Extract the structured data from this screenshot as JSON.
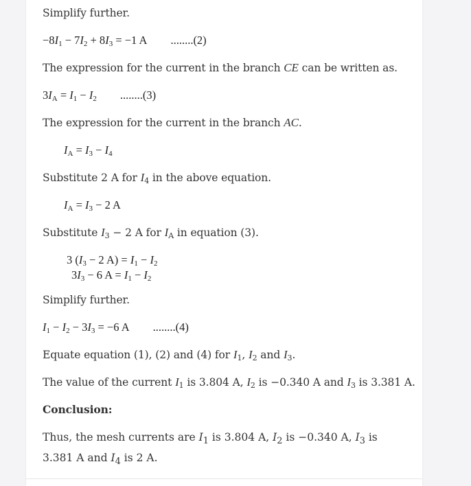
{
  "content": {
    "p1": "Simplify further.",
    "eq2": {
      "lhs_1": "−8",
      "var1": "I",
      "sub1": "1",
      "op1": " − 7",
      "var2": "I",
      "sub2": "2",
      "op2": " + 8",
      "var3": "I",
      "sub3": "3",
      "rhs": " = −1 A",
      "tag": "........(2)"
    },
    "p2": {
      "before": "The expression for the current in the branch ",
      "var": "CE",
      "after": " can be written as."
    },
    "eq3": {
      "lhs": "3",
      "var1": "I",
      "sub1": "A",
      "mid": " = ",
      "var2": "I",
      "sub2": "1",
      "op": " − ",
      "var3": "I",
      "sub3": "2",
      "tag": "........(3)"
    },
    "p3": {
      "before": "The expression for the current in the branch ",
      "var": "AC",
      "after": "."
    },
    "eq_ia": {
      "var1": "I",
      "sub1": "A",
      "mid": " = ",
      "var2": "I",
      "sub2": "3",
      "op": " − ",
      "var3": "I",
      "sub3": "4"
    },
    "p4": {
      "before": "Substitute 2 A for ",
      "var": "I",
      "sub": "4",
      "after": " in the above equation."
    },
    "eq_ia2": {
      "var1": "I",
      "sub1": "A",
      "mid": " = ",
      "var2": "I",
      "sub2": "3",
      "rhs": " − 2 A"
    },
    "p5": {
      "before": "Substitute ",
      "var": "I",
      "sub": "3",
      "mid": " − 2 A for ",
      "var2": "I",
      "sub2": "A",
      "after": " in equation (3)."
    },
    "eq_sub1": {
      "lhs": "3 (",
      "var1": "I",
      "sub1": "3",
      "mid": " − 2 A) = ",
      "var2": "I",
      "sub2": "1",
      "op": " − ",
      "var3": "I",
      "sub3": "2"
    },
    "eq_sub2": {
      "lhs": "3",
      "var1": "I",
      "sub1": "3",
      "mid": " − 6 A = ",
      "var2": "I",
      "sub2": "1",
      "op": " − ",
      "var3": "I",
      "sub3": "2"
    },
    "p6": "Simplify further.",
    "eq4": {
      "var1": "I",
      "sub1": "1",
      "op1": " − ",
      "var2": "I",
      "sub2": "2",
      "op2": " − 3",
      "var3": "I",
      "sub3": "3",
      "rhs": " = −6 A",
      "tag": "........(4)"
    },
    "p7": {
      "before": "Equate equation (1), (2) and (4) for ",
      "var1": "I",
      "sub1": "1",
      "sep1": ", ",
      "var2": "I",
      "sub2": "2",
      "sep2": " and ",
      "var3": "I",
      "sub3": "3",
      "after": "."
    },
    "p8": {
      "before": "The value of the current ",
      "var1": "I",
      "sub1": "1",
      "t1": " is 3.804 A, ",
      "var2": "I",
      "sub2": "2",
      "t2": " is −0.340 A and ",
      "var3": "I",
      "sub3": "3",
      "t3": " is 3.381 A."
    },
    "conclusion_heading": "Conclusion:",
    "p9": {
      "before": "Thus, the mesh currents are ",
      "var1": "I",
      "sub1": "1",
      "t1": " is 3.804 A, ",
      "var2": "I",
      "sub2": "2",
      "t2": " is −0.340 A, ",
      "var3": "I",
      "sub3": "3",
      "t3": " is 3.381 A and ",
      "var4": "I",
      "sub4": "4",
      "t4": " is 2 A."
    }
  }
}
